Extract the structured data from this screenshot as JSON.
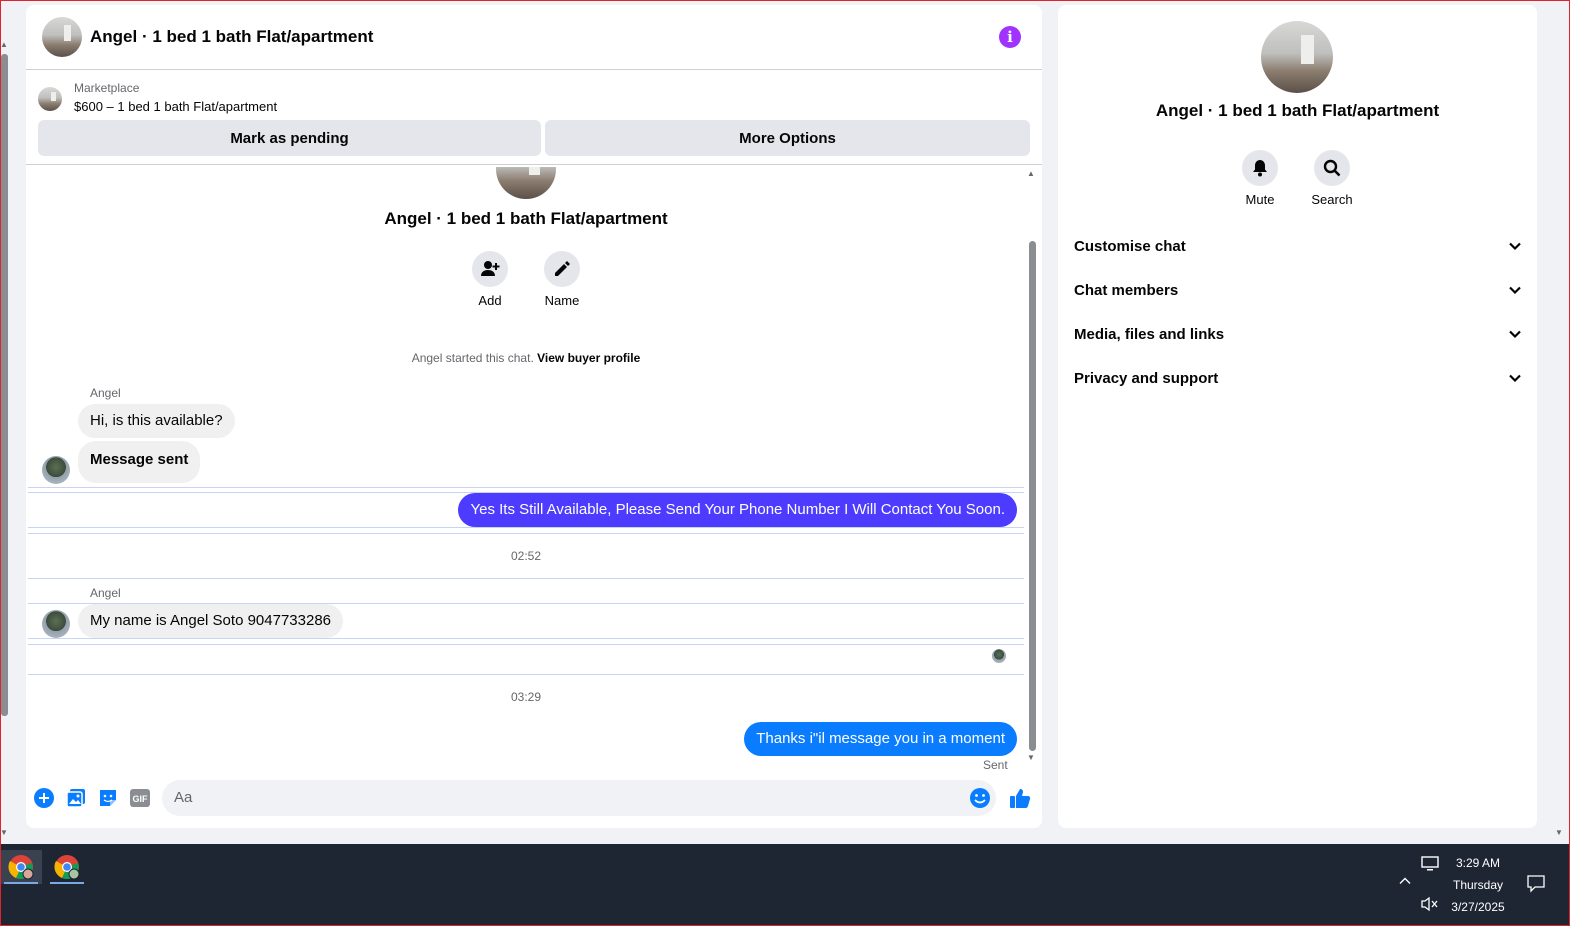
{
  "header": {
    "title": "Angel · 1 bed 1 bath Flat/apartment",
    "info_glyph": "i"
  },
  "marketplace": {
    "label": "Marketplace",
    "listing": "$600 – 1 bed 1 bath Flat/apartment",
    "pending_button": "Mark as pending",
    "more_button": "More Options"
  },
  "profile": {
    "name": "Angel · 1 bed 1 bath Flat/apartment",
    "add_label": "Add",
    "name_label": "Name",
    "started_text": "Angel started this chat.",
    "buyer_link": "View buyer profile"
  },
  "messages": [
    {
      "sender": "Angel",
      "text": "Hi, is this available?"
    },
    {
      "text": "Message sent"
    },
    {
      "text": "Yes Its Still Available, Please Send Your Phone Number I Will Contact You Soon."
    },
    {
      "time": "02:52"
    },
    {
      "sender": "Angel",
      "text": "My name is Angel Soto 9047733286"
    },
    {
      "time": "03:29"
    },
    {
      "text": "Thanks i\"il message you in a moment",
      "status": "Sent"
    }
  ],
  "composer": {
    "placeholder": "Aa",
    "gif_label": "GIF"
  },
  "info_panel": {
    "name": "Angel · 1 bed 1 bath Flat/apartment",
    "mute_label": "Mute",
    "search_label": "Search",
    "menu": [
      "Customise chat",
      "Chat members",
      "Media, files and links",
      "Privacy and support"
    ]
  },
  "taskbar": {
    "time": "3:29 AM",
    "day": "Thursday",
    "date": "3/27/2025"
  },
  "colors": {
    "accent": "#0a7cff",
    "purple_bubble": "#4d3bff",
    "info": "#a033ff",
    "taskbar": "#1e2533"
  }
}
